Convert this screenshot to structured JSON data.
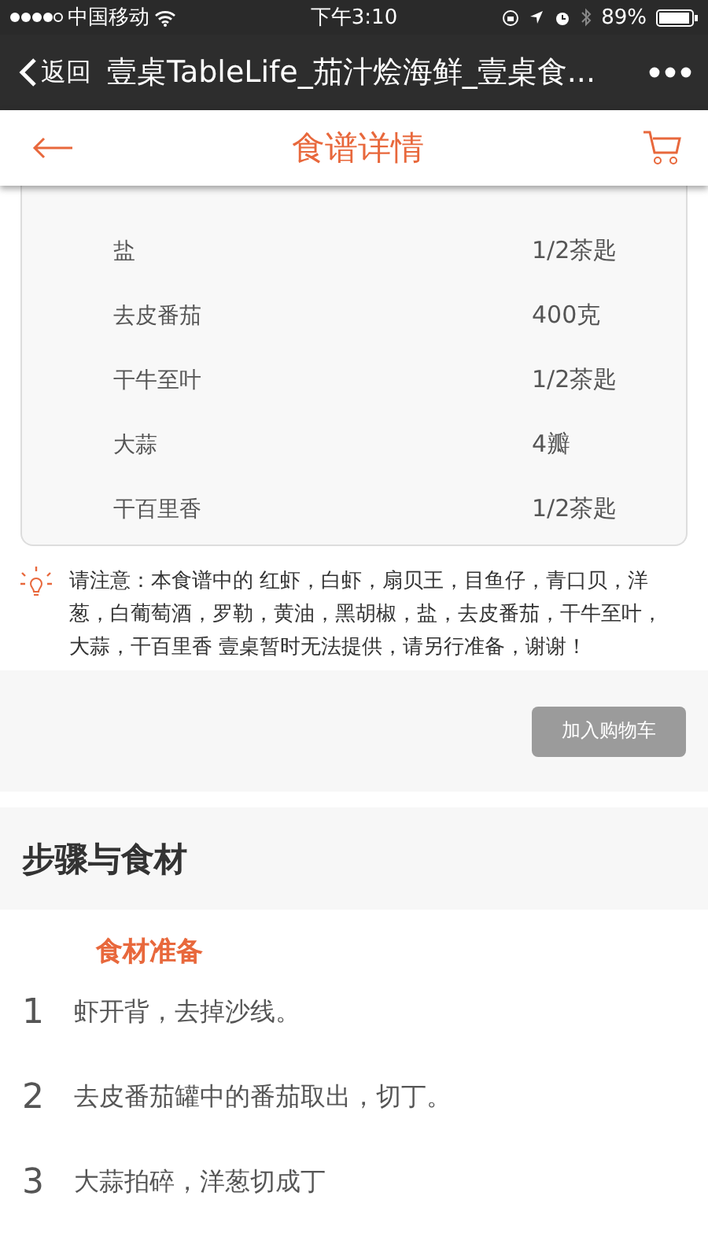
{
  "status_bar": {
    "carrier": "中国移动",
    "time": "下午3:10",
    "battery": "89%"
  },
  "browser_bar": {
    "back": "返回",
    "title": "壹桌TableLife_茄汁烩海鲜_壹桌食..."
  },
  "header": {
    "title": "食谱详情"
  },
  "ingredients": [
    {
      "name": "盐",
      "amount": "1/2茶匙"
    },
    {
      "name": "去皮番茄",
      "amount": "400克"
    },
    {
      "name": "干牛至叶",
      "amount": "1/2茶匙"
    },
    {
      "name": "大蒜",
      "amount": "4瓣"
    },
    {
      "name": "干百里香",
      "amount": "1/2茶匙"
    }
  ],
  "notice": {
    "text": "请注意：本食谱中的 红虾，白虾，扇贝王，目鱼仔，青口贝，洋葱，白葡萄酒，罗勒，黄油，黑胡椒，盐，去皮番茄，干牛至叶，大蒜，干百里香 壹桌暂时无法提供，请另行准备，谢谢！"
  },
  "add_to_cart": {
    "label": "加入购物车",
    "disabled": true
  },
  "steps_section": {
    "title": "步骤与食材",
    "group_title": "食材准备",
    "steps": [
      {
        "number": "1",
        "text": "虾开背，去掉沙线。"
      },
      {
        "number": "2",
        "text": "去皮番茄罐中的番茄取出，切丁。"
      },
      {
        "number": "3",
        "text": "大蒜拍碎，洋葱切成丁"
      }
    ]
  }
}
